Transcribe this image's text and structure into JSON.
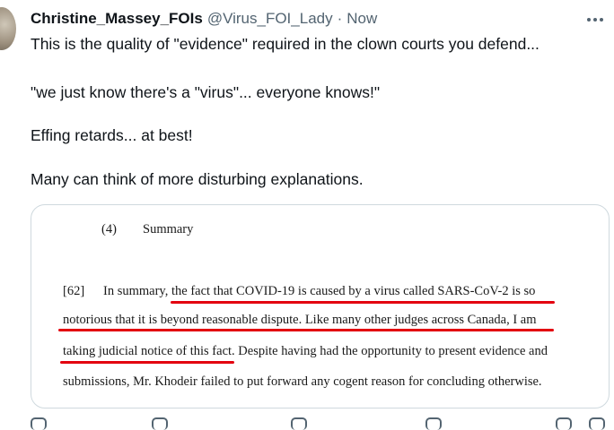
{
  "tweet": {
    "author_name": "Christine_Massey_FOIs",
    "handle": "@Virus_FOI_Lady",
    "separator": "·",
    "time": "Now",
    "lines": [
      "This is the quality of \"evidence\" required in the clown courts you defend...",
      "\"we just know there's a \"virus\"... everyone knows!\"",
      "Effing retards... at best!",
      "Many can think of more disturbing explanations."
    ]
  },
  "document": {
    "section_number": "(4)",
    "section_title": "Summary",
    "para_number": "[62]",
    "line1_plain": "In summary, ",
    "line1_underlined": "the fact that COVID-19 is caused by a virus called SARS-CoV-2 is so",
    "line2": "notorious that it is beyond reasonable dispute. Like many other judges across Canada, I am",
    "line3_underlined": "taking judicial notice of this fact.",
    "line3_rest": " Despite having had the opportunity to present evidence and",
    "line4": "submissions, Mr. Khodeir failed to put forward any cogent reason for concluding otherwise."
  },
  "colors": {
    "accent_red": "#e3000f",
    "muted_text": "#536471",
    "border": "#cfd9de"
  },
  "icons": [
    "more-options-icon",
    "reply-icon",
    "retweet-icon",
    "like-icon",
    "views-icon",
    "bookmark-icon",
    "share-icon"
  ]
}
